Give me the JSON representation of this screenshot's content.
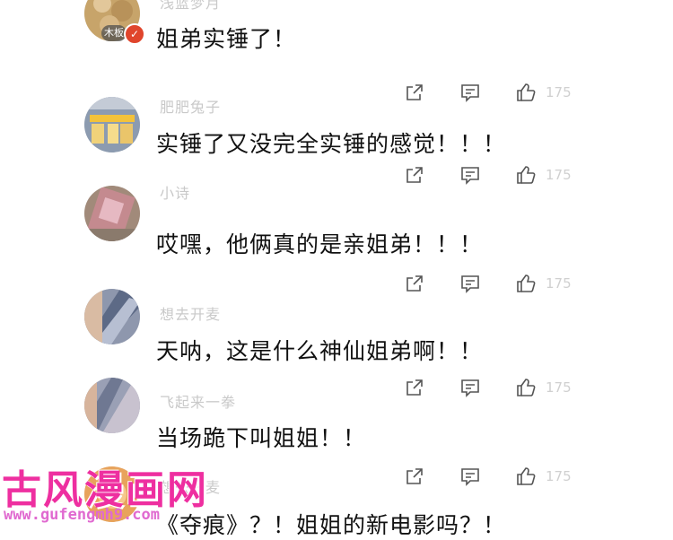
{
  "comments": [
    {
      "username": "浅蓝梦月",
      "badge": "木板",
      "text": "姐弟实锤了！",
      "like_count": "175"
    },
    {
      "username": "肥肥兔子",
      "text": "实锤了又没完全实锤的感觉！！！",
      "like_count": "175"
    },
    {
      "username": "小诗",
      "text": "哎嘿，他俩真的是亲姐弟！！！",
      "like_count": "175"
    },
    {
      "username": "想去开麦",
      "text": "天呐，这是什么神仙姐弟啊！！",
      "like_count": "175"
    },
    {
      "username": "飞起来一拳",
      "text": "当场跪下叫姐姐！！",
      "like_count": "175"
    },
    {
      "username": "想去开麦",
      "text": "《夺痕》？！姐姐的新电影吗？！",
      "like_count": "175"
    }
  ],
  "watermark": {
    "title": "古风漫画网",
    "url": "www.gufengmh9.com"
  },
  "colors": {
    "watermark": "#ee2fa0",
    "muted": "#c9c9c9",
    "text": "#111111"
  }
}
